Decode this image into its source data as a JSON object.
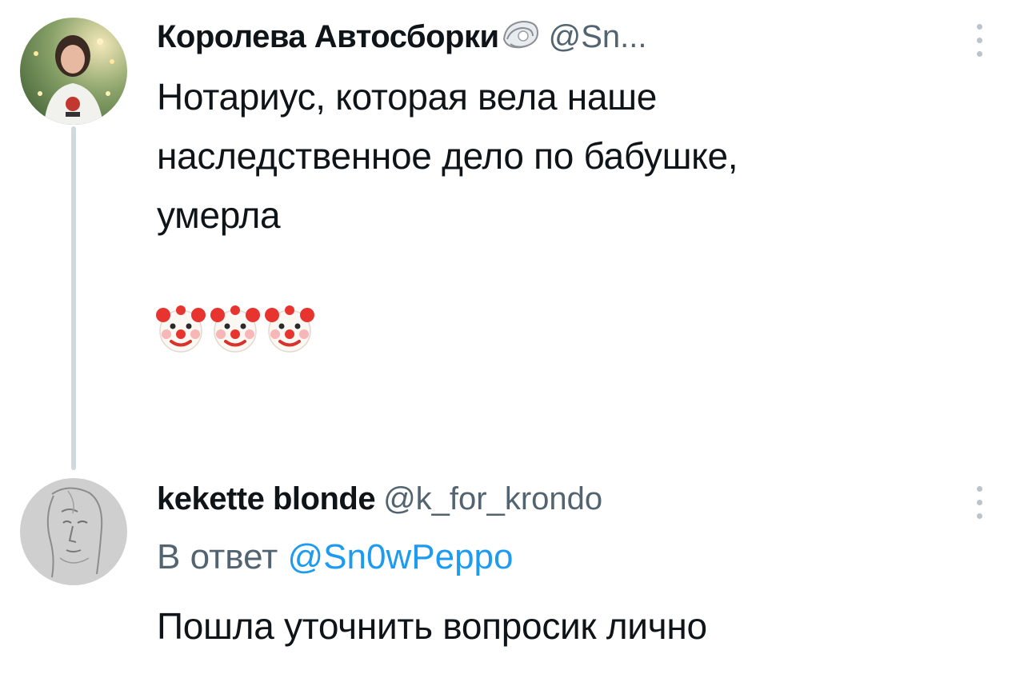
{
  "tweet1": {
    "author_name": "Королева Автосборки",
    "author_handle": "@Sn...",
    "badge_icon": "oyster-emoji",
    "text": "Нотариус, которая вела наше\nнаследственное дело по бабушке,\nумерла",
    "emojis": [
      "clown-face-emoji",
      "clown-face-emoji",
      "clown-face-emoji"
    ],
    "avatar_icon": "profile-photo"
  },
  "tweet2": {
    "author_name": "kekette blonde",
    "author_handle": "@k_for_krondo",
    "reply_prefix": "В ответ",
    "reply_mention": "@Sn0wPeppo",
    "text": "Пошла уточнить вопросик лично",
    "avatar_icon": "sketch-portrait-photo"
  },
  "colors": {
    "text_primary": "#0f1419",
    "text_secondary": "#536471",
    "link": "#1d9bf0",
    "thread_line": "#cfd9de",
    "more_dots": "#b9c4cc"
  }
}
